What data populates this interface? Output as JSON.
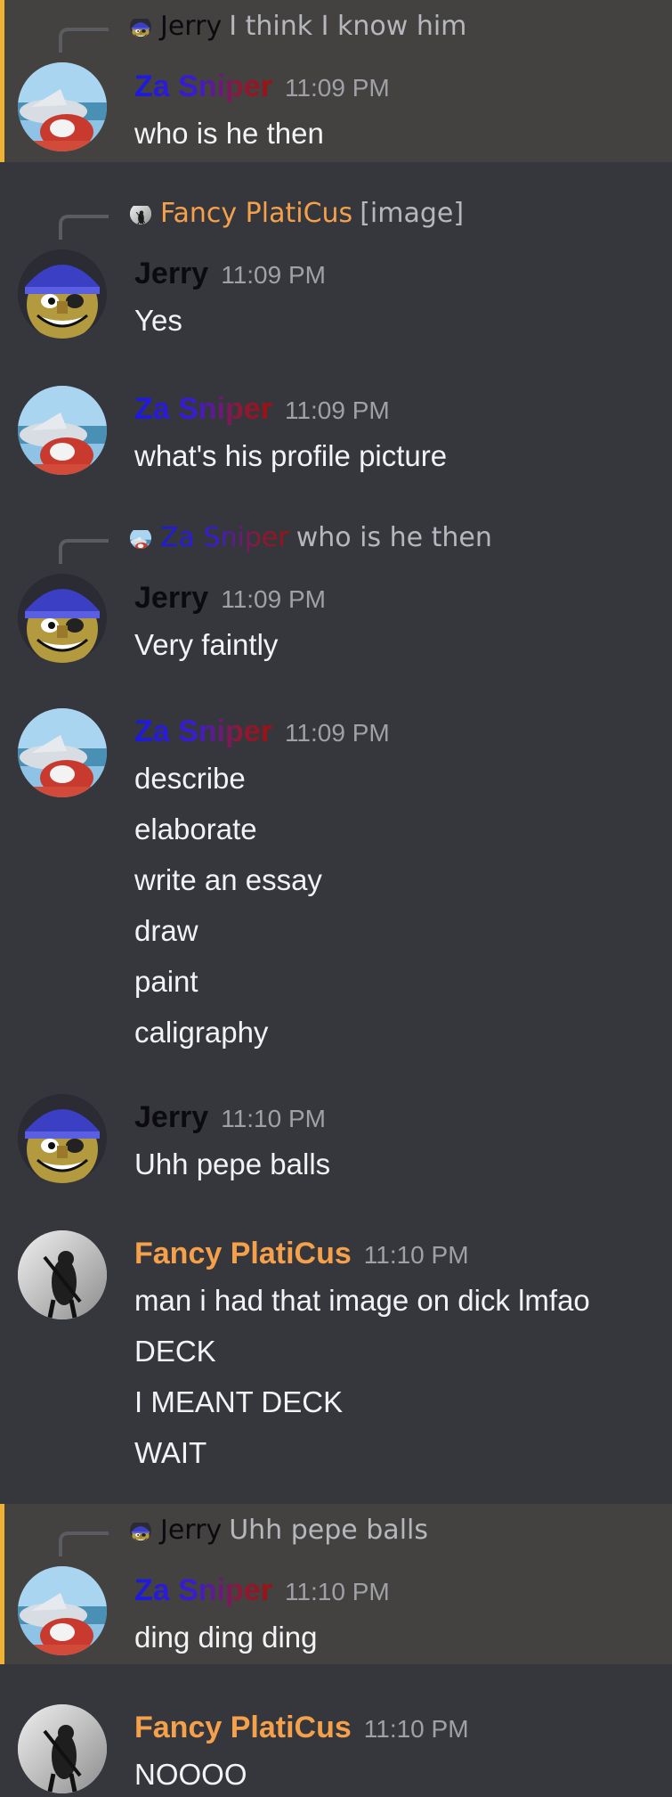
{
  "users": {
    "za": {
      "name": "Za Sniper",
      "gradient": [
        "#1a1adf",
        "#3d1ccf",
        "#8a1a3a",
        "#a01010"
      ]
    },
    "jerry": {
      "name": "Jerry",
      "color": "#0b0b0f"
    },
    "fancy": {
      "name": "Fancy PlatiCus",
      "color": "#f5a04a"
    }
  },
  "theme": {
    "background": "#36373d",
    "highlight_background": "#444240",
    "highlight_bar": "#f0b232",
    "timestamp": "#9fa1a7",
    "reply_text": "#b5b7bc"
  },
  "messages": [
    {
      "author": "Za Sniper",
      "timestamp": "11:09 PM",
      "highlighted": true,
      "reply": {
        "author": "Jerry",
        "text": "I think I know him"
      },
      "lines": [
        "who is he then"
      ]
    },
    {
      "author": "Jerry",
      "timestamp": "11:09 PM",
      "highlighted": false,
      "reply": {
        "author": "Fancy PlatiCus",
        "text": "[image]"
      },
      "lines": [
        "Yes"
      ]
    },
    {
      "author": "Za Sniper",
      "timestamp": "11:09 PM",
      "highlighted": false,
      "lines": [
        "what's his profile picture"
      ]
    },
    {
      "author": "Jerry",
      "timestamp": "11:09 PM",
      "highlighted": false,
      "reply": {
        "author": "Za Sniper",
        "text": "who is he then"
      },
      "lines": [
        "Very faintly"
      ]
    },
    {
      "author": "Za Sniper",
      "timestamp": "11:09 PM",
      "highlighted": false,
      "lines": [
        "describe",
        "elaborate",
        "write an essay",
        "draw",
        "paint",
        "caligraphy"
      ]
    },
    {
      "author": "Jerry",
      "timestamp": "11:10 PM",
      "highlighted": false,
      "lines": [
        "Uhh pepe balls"
      ]
    },
    {
      "author": "Fancy PlatiCus",
      "timestamp": "11:10 PM",
      "highlighted": false,
      "lines": [
        "man i had that image on dick lmfao",
        "DECK",
        "I MEANT DECK",
        "WAIT"
      ]
    },
    {
      "author": "Za Sniper",
      "timestamp": "11:10 PM",
      "highlighted": true,
      "reply": {
        "author": "Jerry",
        "text": "Uhh pepe balls"
      },
      "lines": [
        "ding ding ding"
      ]
    },
    {
      "author": "Fancy PlatiCus",
      "timestamp": "11:10 PM",
      "highlighted": false,
      "lines": [
        "NOOOO"
      ]
    }
  ]
}
